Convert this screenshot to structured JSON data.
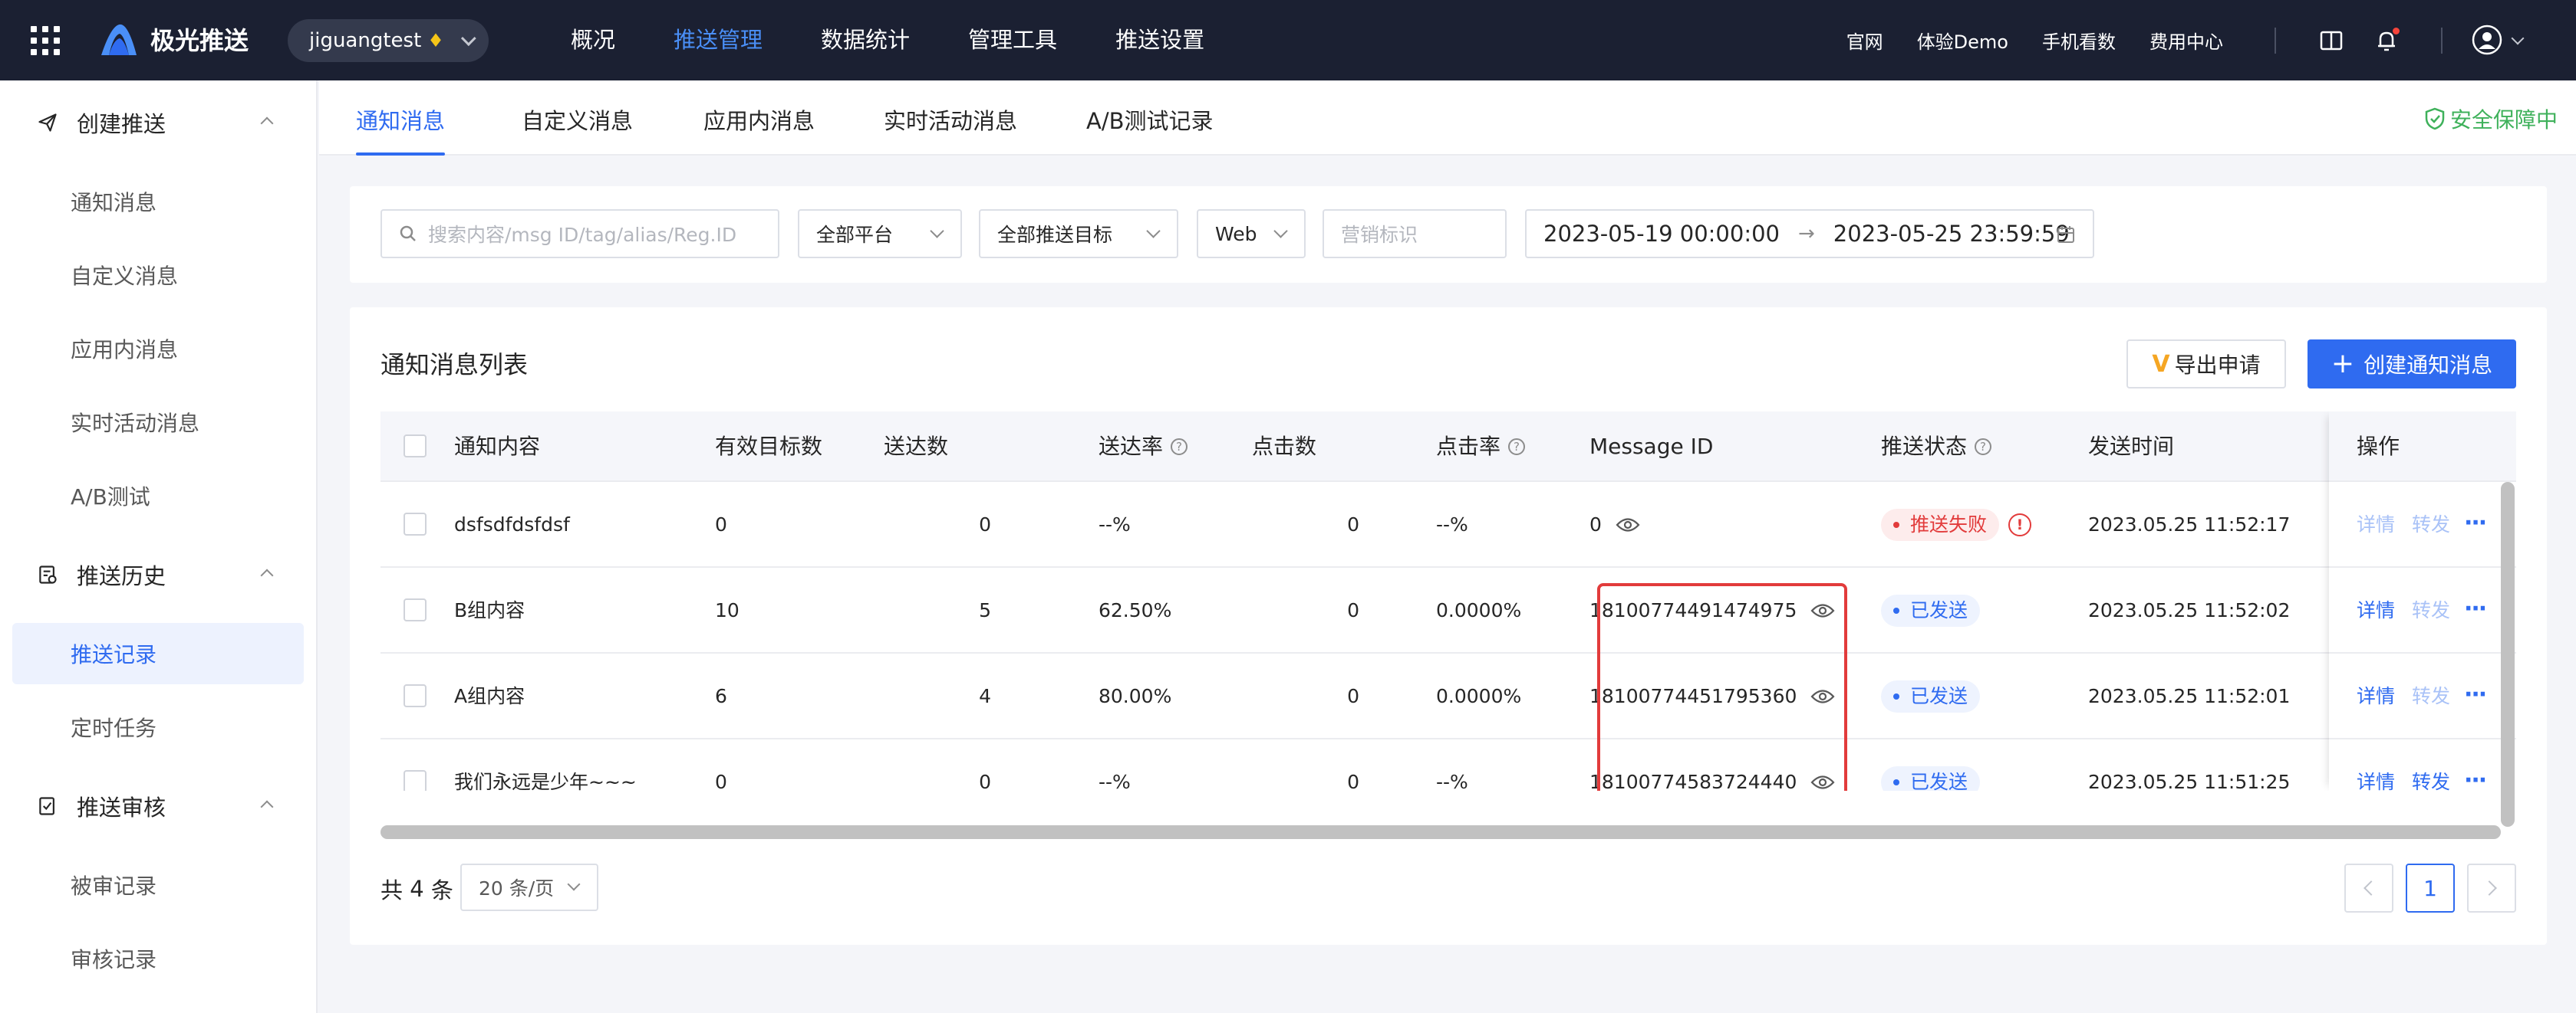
{
  "brand": {
    "name": "极光推送",
    "app": "jiguangtest"
  },
  "topnav": [
    "概况",
    "推送管理",
    "数据统计",
    "管理工具",
    "推送设置"
  ],
  "toplinks": [
    "官网",
    "体验Demo",
    "手机看数",
    "费用中心"
  ],
  "sidebar": {
    "groups": [
      {
        "label": "创建推送",
        "items": [
          "通知消息",
          "自定义消息",
          "应用内消息",
          "实时活动消息",
          "A/B测试"
        ]
      },
      {
        "label": "推送历史",
        "items": [
          "推送记录",
          "定时任务"
        ]
      },
      {
        "label": "推送审核",
        "items": [
          "被审记录",
          "审核记录"
        ]
      }
    ],
    "active_item": "推送记录"
  },
  "tabs": [
    "通知消息",
    "自定义消息",
    "应用内消息",
    "实时活动消息",
    "A/B测试记录"
  ],
  "safety": "安全保障中",
  "filters": {
    "search_placeholder": "搜索内容/msg ID/tag/alias/Reg.ID",
    "platform": "全部平台",
    "target": "全部推送目标",
    "channel": "Web",
    "marketing_placeholder": "营销标识",
    "date_start": "2023-05-19 00:00:00",
    "date_end": "2023-05-25 23:59:59"
  },
  "list": {
    "title": "通知消息列表",
    "export_label": "导出申请",
    "create_label": "创建通知消息",
    "columns": [
      "通知内容",
      "有效目标数",
      "送达数",
      "送达率",
      "点击数",
      "点击率",
      "Message ID",
      "推送状态",
      "发送时间",
      "操作"
    ],
    "rows": [
      {
        "content": "dsfsdfdsfdsf",
        "targets": "0",
        "delivered": "0",
        "rate": "--%",
        "clicks": "0",
        "click_rate": "--%",
        "msg_id": "0",
        "status": "推送失败",
        "status_type": "fail",
        "time": "2023.05.25 11:52:17",
        "detail": "详情",
        "forward": "转发",
        "detail_enabled": false,
        "forward_enabled": false
      },
      {
        "content": "B组内容",
        "targets": "10",
        "delivered": "5",
        "rate": "62.50%",
        "clicks": "0",
        "click_rate": "0.0000%",
        "msg_id": "18100774491474975",
        "status": "已发送",
        "status_type": "ok",
        "time": "2023.05.25 11:52:02",
        "detail": "详情",
        "forward": "转发",
        "detail_enabled": true,
        "forward_enabled": false
      },
      {
        "content": "A组内容",
        "targets": "6",
        "delivered": "4",
        "rate": "80.00%",
        "clicks": "0",
        "click_rate": "0.0000%",
        "msg_id": "18100774451795360",
        "status": "已发送",
        "status_type": "ok",
        "time": "2023.05.25 11:52:01",
        "detail": "详情",
        "forward": "转发",
        "detail_enabled": true,
        "forward_enabled": false
      },
      {
        "content": "我们永远是少年~~~",
        "targets": "0",
        "delivered": "0",
        "rate": "--%",
        "clicks": "0",
        "click_rate": "--%",
        "msg_id": "18100774583724440",
        "status": "已发送",
        "status_type": "ok",
        "time": "2023.05.25 11:51:25",
        "detail": "详情",
        "forward": "转发",
        "detail_enabled": true,
        "forward_enabled": true
      }
    ]
  },
  "pagination": {
    "total_prefix": "共",
    "total": "4",
    "total_suffix": "条",
    "page_size": "20 条/页",
    "current_page": "1"
  },
  "colors": {
    "primary": "#2f6bf0",
    "topbar": "#1b2032",
    "danger": "#e23b3b",
    "success": "#3fb15b"
  }
}
